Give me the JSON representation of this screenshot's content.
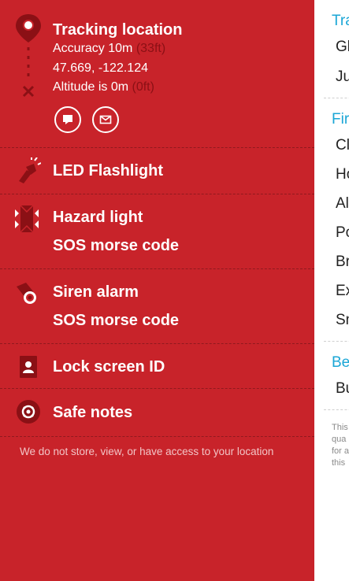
{
  "location": {
    "title": "Tracking location",
    "accuracy_label": "Accuracy 10m",
    "accuracy_ft": "(33ft)",
    "coordinates": "47.669, -122.124",
    "altitude_label": "Altitude is 0m",
    "altitude_ft": "(0ft)"
  },
  "flashlight": {
    "title": "LED Flashlight"
  },
  "hazard": {
    "title": "Hazard light",
    "subtitle": "SOS morse code"
  },
  "siren": {
    "title": "Siren alarm",
    "subtitle": "SOS morse code"
  },
  "lockscreen": {
    "title": "Lock screen ID"
  },
  "notes": {
    "title": "Safe notes"
  },
  "footnote": "We do not store, view, or have access to your location",
  "right_panel": {
    "sections": [
      {
        "heading": "Tra",
        "items": [
          "Gl",
          "Ju"
        ]
      },
      {
        "heading": "Fir",
        "items": [
          "Cl",
          "Ho",
          "Al",
          "Po",
          "Br",
          "Ex",
          "Sn"
        ]
      },
      {
        "heading": "Be",
        "items": [
          "Bu"
        ]
      }
    ],
    "small_text": [
      "This",
      "qua",
      "for a",
      "this"
    ]
  },
  "colors": {
    "red": "#c8232a",
    "accent": "#1aa6d6"
  }
}
